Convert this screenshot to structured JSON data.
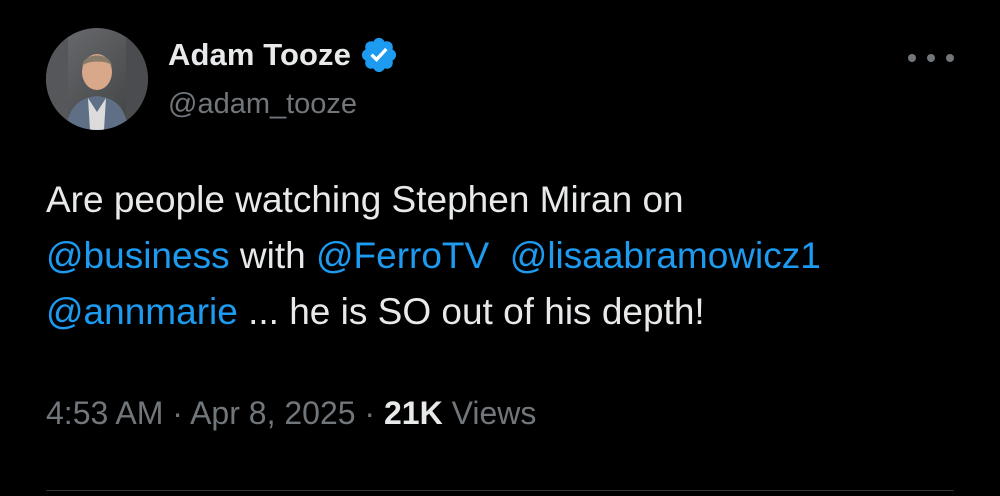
{
  "author": {
    "display_name": "Adam Tooze",
    "handle": "@adam_tooze",
    "verified_icon": "verified-badge-icon",
    "verified_color": "#1d9bf0"
  },
  "tweet": {
    "line1": "Are people watching Stephen Miran on",
    "mention_business": "@business",
    "text_with": " with ",
    "mention_ferro": "@FerroTV",
    "text_gap": "  ",
    "mention_lisa": "@lisaabramowicz1",
    "mention_annmarie": "@annmarie",
    "text_end": " ... he is SO out of his depth!"
  },
  "meta": {
    "time": "4:53 AM",
    "separator1": " · ",
    "date": "Apr 8, 2025",
    "separator2": " · ",
    "views_count": "21K",
    "views_label": " Views"
  },
  "colors": {
    "background": "#000000",
    "text": "#e7e9ea",
    "secondary": "#71767b",
    "link": "#1d9bf0"
  },
  "more_icon": "more-horizontal-icon"
}
